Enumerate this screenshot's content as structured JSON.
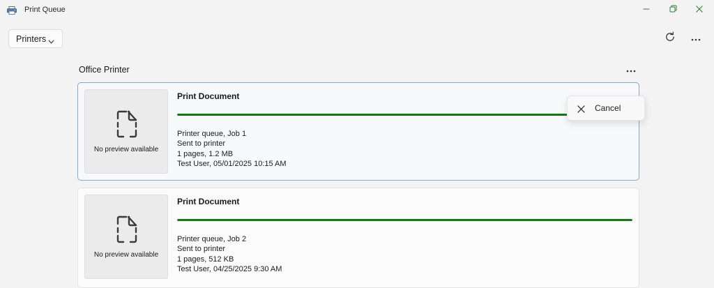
{
  "window": {
    "title": "Print Queue"
  },
  "toolbar": {
    "printers_label": "Printers"
  },
  "section": {
    "title": "Office Printer"
  },
  "jobs": [
    {
      "title": "Print Document",
      "preview_text": "No preview available",
      "queue_line": "Printer queue, Job 1",
      "status": "Sent to printer",
      "details": "1 pages, 1.2 MB",
      "owner_time": "Test User, 05/01/2025 10:15 AM",
      "progress": 1.0,
      "selected": true
    },
    {
      "title": "Print Document",
      "preview_text": "No preview available",
      "queue_line": "Printer queue, Job 2",
      "status": "Sent to printer",
      "details": "1 pages, 512 KB",
      "owner_time": "Test User, 04/25/2025 9:30 AM",
      "progress": 1.0,
      "selected": false
    }
  ],
  "context_menu": {
    "items": [
      {
        "label": "Cancel",
        "icon": "close-icon"
      }
    ]
  },
  "icons": {
    "app": "printer-icon",
    "minimize": "minimize-icon",
    "maximize": "restore-icon",
    "close": "close-icon",
    "dropdown": "chevron-down-icon",
    "refresh": "refresh-icon",
    "more": "more-icon",
    "document": "document-icon"
  },
  "colors": {
    "progress": "#107c10",
    "window_controls": "#2e7d32",
    "selected_border": "#8aa7cf"
  }
}
